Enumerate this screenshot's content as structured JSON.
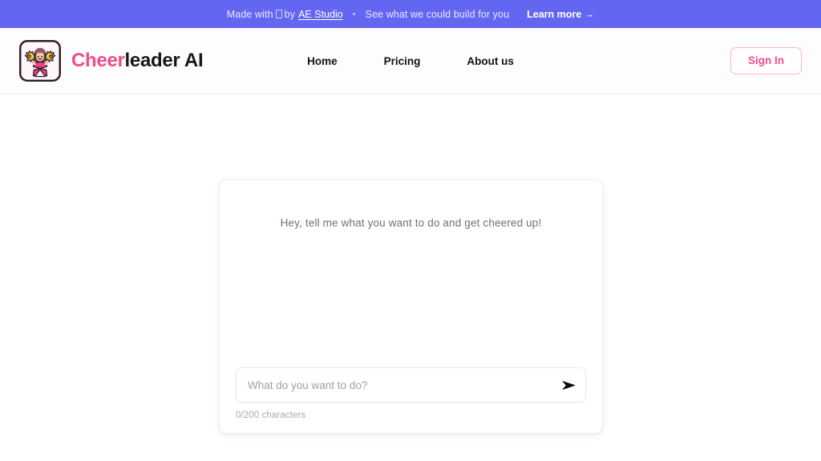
{
  "banner": {
    "prefix": "Made with",
    "emoji_glyph": "missing-glyph-box",
    "by": "by",
    "studio_link": "AE Studio",
    "separator": "•",
    "tagline": "See what we could build for you",
    "cta": "Learn more →",
    "background_color": "#6366f1",
    "text_color": "#e9eaff"
  },
  "header": {
    "logo_icon": "cheerleader-icon",
    "brand_accent": "Cheer",
    "brand_rest": "leader AI",
    "accent_color": "#ef4d89",
    "nav": [
      {
        "label": "Home"
      },
      {
        "label": "Pricing"
      },
      {
        "label": "About us"
      }
    ],
    "signin_label": "Sign In",
    "signin_border_color": "#f7b4cd"
  },
  "chat": {
    "greeting": "Hey, tell me what you want to do and get cheered up!",
    "input_value": "",
    "input_placeholder": "What do you want to do?",
    "send_icon": "send-arrow-icon",
    "char_counter": "0/200 characters",
    "char_current": 0,
    "char_max": 200
  }
}
